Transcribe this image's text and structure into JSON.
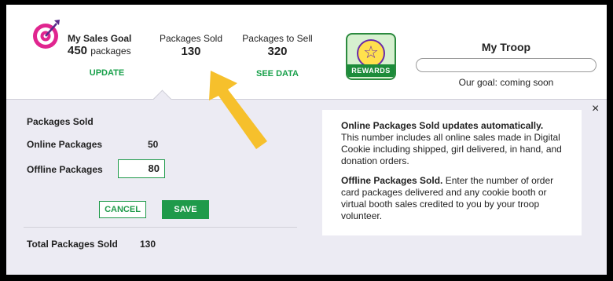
{
  "goal": {
    "title": "My Sales Goal",
    "value": "450",
    "unit": "packages",
    "update_label": "UPDATE"
  },
  "sold": {
    "label": "Packages Sold",
    "value": "130"
  },
  "to_sell": {
    "label": "Packages to Sell",
    "value": "320",
    "see_data_label": "SEE DATA"
  },
  "rewards": {
    "badge_text": "REWARDS",
    "icon": "star-icon",
    "star_glyph": "☆"
  },
  "troop": {
    "title": "My Troop",
    "goal_note": "Our goal: coming soon"
  },
  "panel": {
    "title": "Packages Sold",
    "online_label": "Online Packages",
    "online_value": "50",
    "offline_label": "Offline Packages",
    "offline_value": "80",
    "cancel_label": "CANCEL",
    "save_label": "SAVE",
    "total_label": "Total Packages Sold",
    "total_value": "130",
    "close_glyph": "×"
  },
  "info": {
    "online_bold": "Online Packages Sold updates automatically.",
    "online_text": " This number includes all online sales made in Digital Cookie including shipped, girl delivered, in hand, and donation orders.",
    "offline_bold": "Offline Packages Sold.",
    "offline_text": " Enter the number of order card packages delivered and any cookie booth or virtual booth sales credited to you by your troop volunteer."
  },
  "colors": {
    "accent_green": "#1f9a4a",
    "target_magenta": "#e0258f",
    "arrow_yellow": "#f6c02c",
    "panel_bg": "#ecebf3"
  }
}
